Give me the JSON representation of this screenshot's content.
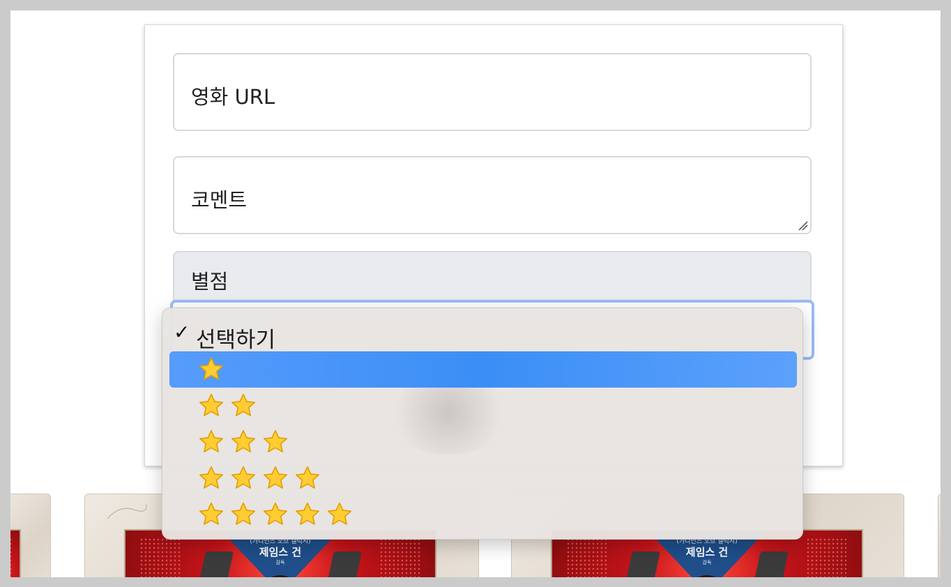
{
  "form": {
    "url_placeholder": "영화 URL",
    "comment_placeholder": "코멘트",
    "rating_label": "별점"
  },
  "dropdown": {
    "options": [
      {
        "label": "선택하기",
        "checked": true,
        "stars": 0
      },
      {
        "label": "⭐",
        "stars": 1,
        "highlighted": true
      },
      {
        "label": "⭐⭐",
        "stars": 2
      },
      {
        "label": "⭐⭐⭐",
        "stars": 3
      },
      {
        "label": "⭐⭐⭐⭐",
        "stars": 4
      },
      {
        "label": "⭐⭐⭐⭐⭐",
        "stars": 5
      }
    ],
    "check_mark": "✓"
  },
  "cards": [
    {
      "line1": "(가디언즈 오브 갤럭시)",
      "line2": "제임스 건",
      "line3": "감독"
    },
    {
      "line1": "(가디언즈 오브 갤럭시)",
      "line2": "제임스 건",
      "line3": "감독"
    }
  ],
  "colors": {
    "highlight": "#3b8ef6",
    "focus_ring": "#9bbcf3",
    "star_fill": "#ffcc33",
    "star_stroke": "#e0a100",
    "poster_red": "#c8141a"
  }
}
